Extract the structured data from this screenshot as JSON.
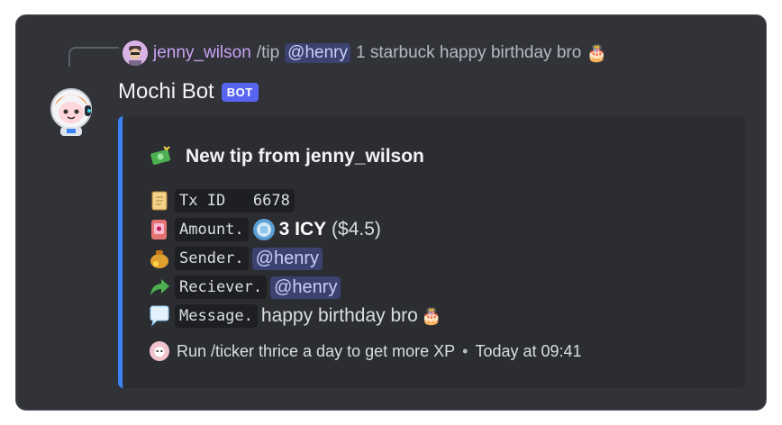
{
  "reply": {
    "username": "jenny_wilson",
    "command": "/tip",
    "mention": "@henry",
    "text": "1 starbuck happy birthday bro",
    "emoji": "🎂"
  },
  "message": {
    "bot_name": "Mochi Bot",
    "bot_tag": "BOT"
  },
  "embed": {
    "accent_color": "#3b82f6",
    "title": "New tip from jenny_wilson",
    "title_icon": "money-icon",
    "fields": {
      "tx_label": "Tx ID",
      "tx_value": "6678",
      "amount_label": "Amount.",
      "amount_value": "3 ICY",
      "amount_usd": "($4.5)",
      "sender_label": "Sender.",
      "sender_value": "@henry",
      "receiver_label": "Reciever.",
      "receiver_value": "@henry",
      "message_label": "Message.",
      "message_value": "happy birthday bro",
      "message_emoji": "🎂"
    },
    "footer": {
      "text": "Run /ticker thrice a day to get more XP",
      "separator": "•",
      "timestamp": "Today at 09:41"
    }
  },
  "colors": {
    "background": "#313338",
    "embed_bg": "#2b2d31",
    "bot_tag": "#5865f2",
    "mention_bg": "#3c4270",
    "username": "#c9a3f5"
  }
}
